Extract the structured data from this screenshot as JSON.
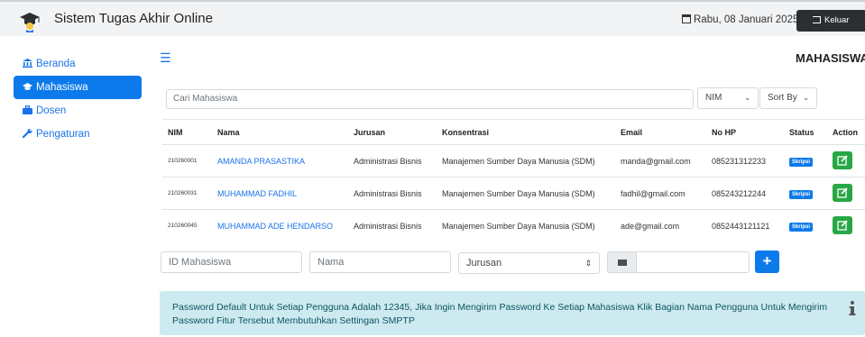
{
  "header": {
    "app_title": "Sistem Tugas Akhir Online",
    "date": "Rabu, 08 Januari 2025",
    "logout_label": "Keluar"
  },
  "sidebar": {
    "items": [
      {
        "label": "Beranda",
        "icon": "bank-icon",
        "active": false
      },
      {
        "label": "Mahasiswa",
        "icon": "graduation-cap-icon",
        "active": true
      },
      {
        "label": "Dosen",
        "icon": "briefcase-icon",
        "active": false
      },
      {
        "label": "Pengaturan",
        "icon": "wrench-icon",
        "active": false
      }
    ]
  },
  "main": {
    "heading": "MAHASISWA",
    "search_placeholder": "Cari Mahasiswa",
    "filter_select": "NIM",
    "sort_select": "Sort By"
  },
  "table": {
    "headers": [
      "NIM",
      "Nama",
      "Jurusan",
      "Konsentrasi",
      "Email",
      "No HP",
      "Status",
      "Action"
    ],
    "rows": [
      {
        "nim": "210260001",
        "nama": "AMANDA PRASASTIKA",
        "jurusan": "Administrasi Bisnis",
        "konsentrasi": "Manajemen Sumber Daya Manusia (SDM)",
        "email": "manda@gmail.com",
        "hp": "085231312233",
        "status": "Skripsi"
      },
      {
        "nim": "210260031",
        "nama": "MUHAMMAD FADHIL",
        "jurusan": "Administrasi Bisnis",
        "konsentrasi": "Manajemen Sumber Daya Manusia (SDM)",
        "email": "fadhil@gmail.com",
        "hp": "085243212244",
        "status": "Skripsi"
      },
      {
        "nim": "210260045",
        "nama": "MUHAMMAD ADE HENDARSO",
        "jurusan": "Administrasi Bisnis",
        "konsentrasi": "Manajemen Sumber Daya Manusia (SDM)",
        "email": "ade@gmail.com",
        "hp": "0852443121121",
        "status": "Skripsi"
      }
    ]
  },
  "form": {
    "id_placeholder": "ID Mahasiswa",
    "nama_placeholder": "Nama",
    "jurusan_selected": "Jurusan",
    "add_label": "+"
  },
  "alert": {
    "text": "Password Default Untuk Setiap Pengguna Adalah 12345, Jika Ingin Mengirim Password Ke Setiap Mahasiswa Klik Bagian Nama Pengguna Untuk Mengirim Password Fitur Tersebut Membutuhkan Settingan SMPTP"
  },
  "colors": {
    "primary": "#0d7aeb",
    "success": "#28a745",
    "info_bg": "#cdeaf0",
    "dark_button": "#2b2f33"
  }
}
